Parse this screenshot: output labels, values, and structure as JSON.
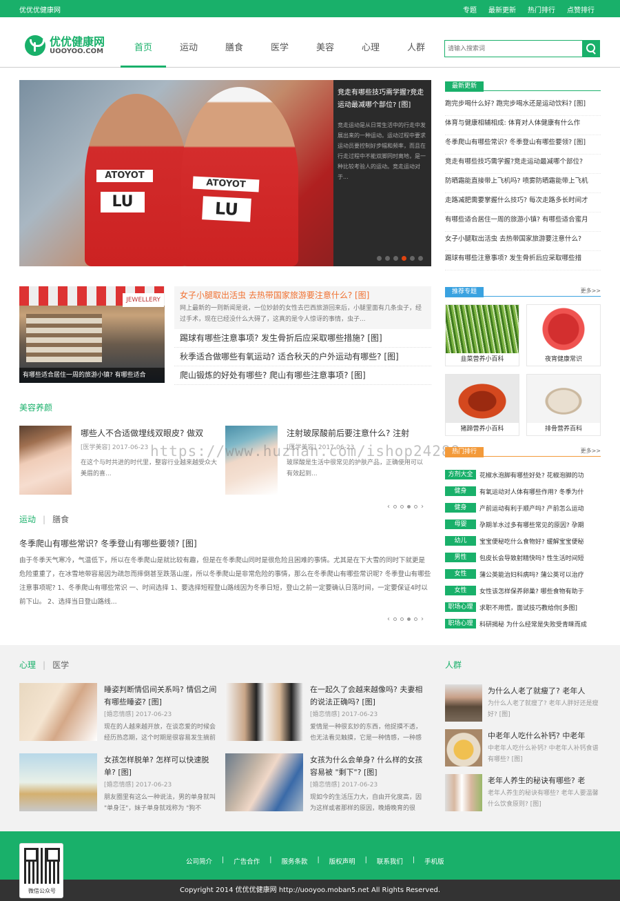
{
  "topbar": {
    "site": "优优优健康网",
    "links": [
      "专题",
      "最新更新",
      "热门排行",
      "点赞排行"
    ]
  },
  "header": {
    "logo_cn": "优优健康网",
    "logo_en": "UOOYOO.COM",
    "nav": [
      "首页",
      "运动",
      "膳食",
      "医学",
      "美容",
      "心理",
      "人群"
    ],
    "search_placeholder": "请输入搜索词"
  },
  "slider": {
    "title": "竞走有哪些技巧需学握?竞走运动最减哪个部位? [图]",
    "desc": "竞走运动是从日常生活中的行走中发展出来的一种运动。运动过程中要求运动员要控制好步幅和频率，而且在行走过程中不能双脚同时离地，是一种比较考验人的运动。竞走运动对于...",
    "bib1": "LU",
    "bib2": "LU",
    "brand": "ATOYOT"
  },
  "latest": {
    "tag": "最新更新",
    "items": [
      "跑完步喝什么好? 跑完步喝水还是运动饮料? [图]",
      "体育与健康相辅相成: 体育对人体健康有什么作",
      "冬季爬山有哪些常识? 冬季登山有哪些要领? [图]",
      "竞走有哪些技巧需学握?竞走运动最减哪个部位?",
      "防晒霜能直接带上飞机吗? 喷雾防晒霜能带上飞机",
      "走路减肥需要掌握什么技巧? 每次走路多长时间才",
      "有哪些适合居住一周的旅游小镇? 有哪些适合蜜月",
      "女子小腿取出活虫 去热带国家旅游要注意什么?",
      "踢球有哪些注意事项? 发生骨折后应采取哪些措"
    ]
  },
  "feature": {
    "caption": "有哪些适合居住一周的旅游小镇? 有哪些适合",
    "top_title": "女子小腿取出活虫 去热带国家旅游要注意什么? [图]",
    "top_desc": "网上最新的一则新闻是说，一位妙龄的女性去巴西旅游回来后，小腿里面有几条虫子，经过手术，现在已经没什么大碍了，这真的是令人惊讶的事情，虫子...",
    "rows": [
      "踢球有哪些注意事项? 发生骨折后应采取哪些措施? [图]",
      "秋季适合做哪些有氧运动? 适合秋天的户外运动有哪些? [图]",
      "爬山锻炼的好处有哪些? 爬山有哪些注意事项? [图]"
    ],
    "shop_sign": "JEWELLERY"
  },
  "beauty": {
    "heading": "美容养颜",
    "items": [
      {
        "title": "哪些人不合适做埋线双眼皮? 做双",
        "meta": "[医学美容]  2017-06-23",
        "desc": "在这个与时共进的时代里，整容行业越来越受众大美眉的喜..."
      },
      {
        "title": "注射玻尿酸前后要注意什么? 注射",
        "meta": "[医学美容]  2017-06-23",
        "desc": "玻尿酸是生活中很常见的护肤产品，正确使用可以有效起到..."
      }
    ]
  },
  "sport": {
    "tab1": "运动",
    "tab2": "膳食",
    "title": "冬季爬山有哪些常识? 冬季登山有哪些要领? [图]",
    "text": "由于冬季天气寒冷，气温低下，所以在冬季爬山是就比较有趣，但是在冬季爬山同时是很危险且困难的事情。尤其是在下大雪的同时下就更是危险重重了，在冰雪地带容易因为疏忽而摔倒甚至跌落山崖，所以冬季爬山是非常危险的事情，那么在冬季爬山有哪些常识呢? 冬季登山有哪些注意事项呢? 1、冬季爬山有哪些常识 一、时间选择 1、要选择短程登山路线因为冬季日短，登山之前一定要确认日落时间，一定要保证4时以前下山。 2、选择当日登山路线..."
  },
  "topics": {
    "tag": "推荐专题",
    "more": "更多>>",
    "items": [
      "韭菜营养小百科",
      "夜宵健康常识",
      "猪蹄营养小百科",
      "排骨营养百科"
    ]
  },
  "rank": {
    "tag": "热门排行",
    "more": "更多>>",
    "items": [
      {
        "tag": "方剂大全",
        "text": "花椒水泡脚有哪些好处? 花椒泡脚的功"
      },
      {
        "tag": "健身",
        "text": "有氧运动对人体有哪些作用? 冬季为什"
      },
      {
        "tag": "健身",
        "text": "产前运动有利于顺产吗? 产前怎么运动"
      },
      {
        "tag": "母婴",
        "text": "孕期羊水过多有哪些常见的原因? 孕期"
      },
      {
        "tag": "幼儿",
        "text": "宝宝便秘吃什么食物好? 缓解宝宝便秘"
      },
      {
        "tag": "男性",
        "text": "包皮长会导致射精快吗? 性生活时间短"
      },
      {
        "tag": "女性",
        "text": "蒲公英能治妇科病吗? 蒲公英可以治疗"
      },
      {
        "tag": "女性",
        "text": "女性该怎样保养卵巢? 哪些食物有助于"
      },
      {
        "tag": "职场心理",
        "text": "求职不用慌，面试技巧教给你[多图]"
      },
      {
        "tag": "职场心理",
        "text": "科研揭秘 为什么经常是失败受青睐而成"
      }
    ]
  },
  "psych": {
    "tab1": "心理",
    "tab2": "医学",
    "items": [
      {
        "title": "睡姿判断情侣间关系吗? 情侣之间有哪些睡姿? [图]",
        "meta": "[婚恋情感]  2017-06-23",
        "desc": "现在的人越来越开放，在谈恋爱的时候会经历热恋期，这个时期是很容易发生摘前"
      },
      {
        "title": "在一起久了会越来越像吗? 夫妻相的说法正确吗? [图]",
        "meta": "[婚恋情感]  2017-06-23",
        "desc": "爱情是一种很玄妙的东西，他捉摸不透，也无法看见触摸，它是一种情感，一种感"
      },
      {
        "title": "女孩怎样脱单? 怎样可以快速脱单? [图]",
        "meta": "[婚恋情感]  2017-06-23",
        "desc": "朋友圈里有这么一种说法，男的单身就叫 \"单身汪\"，妹子单身就戏称为 \"狗不"
      },
      {
        "title": "女孩为什么会单身? 什么样的女孩容易被 \"剩下\"? [图]",
        "meta": "[婚恋情感]  2017-06-23",
        "desc": "现如今的生活压力大，自由开化度高，因为这样或者那样的原因，晚婚晚育的很"
      }
    ]
  },
  "people": {
    "heading": "人群",
    "items": [
      {
        "title": "为什么人老了就瘦了? 老年人",
        "desc": "为什么人老了就瘦了? 老年人胖好还是瘦好? [图]"
      },
      {
        "title": "中老年人吃什么补钙? 中老年",
        "desc": "中老年人吃什么补钙? 中老年人补钙食谱有哪些? [图]"
      },
      {
        "title": "老年人养生的秘诀有哪些? 老",
        "desc": "老年人养生的秘诀有哪些? 老年人要温馨什么饮食原则? [图]"
      }
    ]
  },
  "footer": {
    "links": [
      "公司简介",
      "广告合作",
      "服务条款",
      "版权声明",
      "联系我们",
      "手机版"
    ],
    "qr_label": "微信公众号",
    "copyright": "Copyright 2014 优优优健康网 http://uooyoo.moban5.net All Rights Reserved."
  },
  "watermark": "https://www.huzhan.com/ishop24289",
  "colors": {
    "brand": "#19b06a",
    "accent": "#f07030",
    "dark": "#333333"
  }
}
